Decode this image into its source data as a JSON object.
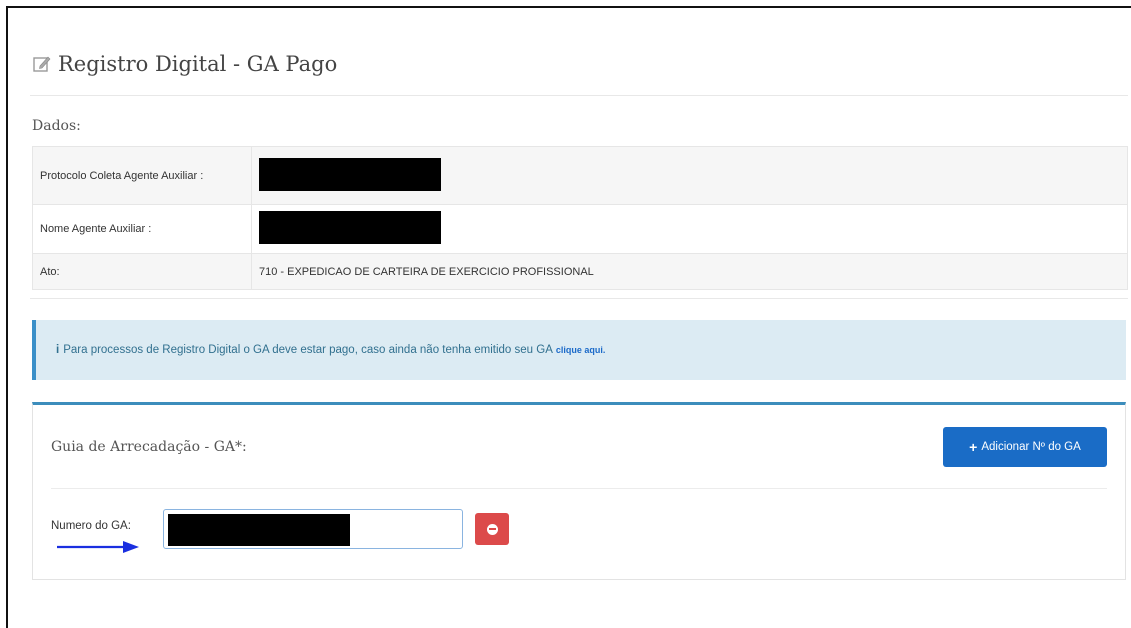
{
  "header": {
    "title": "Registro Digital - GA Pago",
    "icon": "edit-icon"
  },
  "dados": {
    "label": "Dados:",
    "rows": [
      {
        "key": "Protocolo Coleta Agente Auxiliar :",
        "value": "",
        "redacted": true
      },
      {
        "key": "Nome Agente Auxiliar :",
        "value": "",
        "redacted": true
      },
      {
        "key": "Ato:",
        "value": "710 - EXPEDICAO DE CARTEIRA DE EXERCICIO PROFISSIONAL",
        "redacted": false
      }
    ]
  },
  "alert": {
    "icon": "info-icon",
    "text": "Para processos de Registro Digital o GA deve estar pago, caso ainda não tenha emitido seu GA",
    "link": "clique aqui."
  },
  "panel": {
    "title": "Guia de Arrecadação - GA*:",
    "add_button": "Adicionar Nº do GA",
    "field_label": "Numero do GA:",
    "field_value": ""
  },
  "colors": {
    "primary": "#1a6cc6",
    "danger": "#dc4a4a",
    "info_bg": "#dcebf3",
    "info_border": "#3a8fc8",
    "arrow": "#1a2fe0"
  }
}
